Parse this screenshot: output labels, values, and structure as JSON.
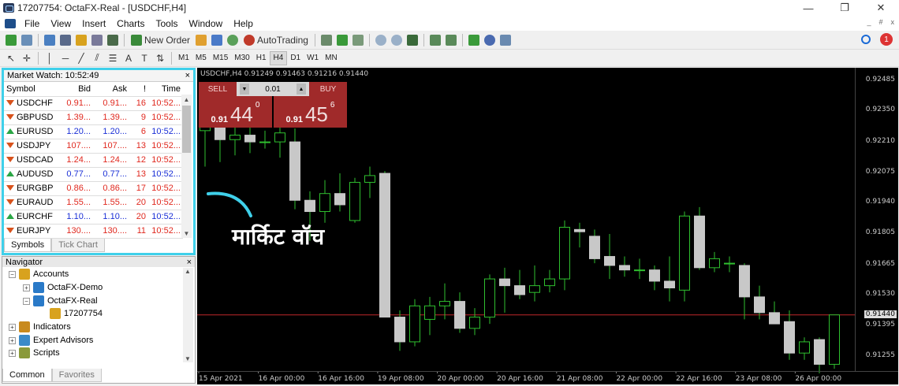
{
  "window": {
    "title": "17207754: OctaFX-Real - [USDCHF,H4]",
    "minimize": "—",
    "maximize": "❐",
    "close": "✕"
  },
  "menu": {
    "items": [
      "File",
      "View",
      "Insert",
      "Charts",
      "Tools",
      "Window",
      "Help"
    ],
    "mdi_controls": [
      "_",
      "#",
      "x"
    ]
  },
  "toolbar": {
    "new_order": "New Order",
    "autotrading": "AutoTrading",
    "timeframes": [
      "M1",
      "M5",
      "M15",
      "M30",
      "H1",
      "H4",
      "D1",
      "W1",
      "MN"
    ],
    "active_timeframe": "H4",
    "notification_count": "1",
    "drawing": {
      "text_tool": "A",
      "text_label_tool": "T"
    }
  },
  "market_watch": {
    "title": "Market Watch: 10:52:49",
    "close": "×",
    "columns": [
      "Symbol",
      "Bid",
      "Ask",
      "!",
      "Time"
    ],
    "rows": [
      {
        "symbol": "USDCHF",
        "dir": "down",
        "bid": "0.91...",
        "ask": "0.91...",
        "spread": "16",
        "time": "10:52...",
        "color": "red"
      },
      {
        "symbol": "GBPUSD",
        "dir": "down",
        "bid": "1.39...",
        "ask": "1.39...",
        "spread": "9",
        "time": "10:52...",
        "color": "red"
      },
      {
        "symbol": "EURUSD",
        "dir": "up",
        "bid": "1.20...",
        "ask": "1.20...",
        "spread": "6",
        "time": "10:52...",
        "color": "blue"
      },
      {
        "symbol": "USDJPY",
        "dir": "down",
        "bid": "107....",
        "ask": "107....",
        "spread": "13",
        "time": "10:52...",
        "color": "red"
      },
      {
        "symbol": "USDCAD",
        "dir": "down",
        "bid": "1.24...",
        "ask": "1.24...",
        "spread": "12",
        "time": "10:52...",
        "color": "red"
      },
      {
        "symbol": "AUDUSD",
        "dir": "up",
        "bid": "0.77...",
        "ask": "0.77...",
        "spread": "13",
        "time": "10:52...",
        "color": "blue"
      },
      {
        "symbol": "EURGBP",
        "dir": "down",
        "bid": "0.86...",
        "ask": "0.86...",
        "spread": "17",
        "time": "10:52...",
        "color": "red"
      },
      {
        "symbol": "EURAUD",
        "dir": "down",
        "bid": "1.55...",
        "ask": "1.55...",
        "spread": "20",
        "time": "10:52...",
        "color": "red"
      },
      {
        "symbol": "EURCHF",
        "dir": "up",
        "bid": "1.10...",
        "ask": "1.10...",
        "spread": "20",
        "time": "10:52...",
        "color": "blue"
      },
      {
        "symbol": "EURJPY",
        "dir": "down",
        "bid": "130....",
        "ask": "130....",
        "spread": "11",
        "time": "10:52...",
        "color": "red"
      }
    ],
    "tabs": [
      "Symbols",
      "Tick Chart"
    ],
    "active_tab": "Symbols"
  },
  "navigator": {
    "title": "Navigator",
    "close": "×",
    "items": {
      "accounts": "Accounts",
      "demo": "OctaFX-Demo",
      "real": "OctaFX-Real",
      "account_number": "17207754",
      "indicators": "Indicators",
      "experts": "Expert Advisors",
      "scripts": "Scripts"
    },
    "tabs": [
      "Common",
      "Favorites"
    ],
    "active_tab": "Common"
  },
  "one_click": {
    "sell": "SELL",
    "buy": "BUY",
    "lot": "0.01",
    "sell_prefix": "0.91",
    "sell_big": "44",
    "sell_sup": "0",
    "buy_prefix": "0.91",
    "buy_big": "45",
    "buy_sup": "6"
  },
  "chart": {
    "info": "USDCHF,H4  0.91249 0.91463 0.91216 0.91440",
    "current_price": "0.91440",
    "price_line_color": "#c0282a"
  },
  "annotation": {
    "text": "मार्किट वॉच",
    "color": "#3fd0ea"
  },
  "chart_data": {
    "type": "candlestick",
    "symbol": "USDCHF",
    "timeframe": "H4",
    "y_ticks": [
      "0.92485",
      "0.92350",
      "0.92210",
      "0.92075",
      "0.91940",
      "0.91805",
      "0.91665",
      "0.91530",
      "0.91395",
      "0.91255"
    ],
    "ylim": [
      0.9119,
      0.9254
    ],
    "x_ticks": [
      "15 Apr 2021",
      "16 Apr 00:00",
      "16 Apr 16:00",
      "19 Apr 08:00",
      "20 Apr 00:00",
      "20 Apr 16:00",
      "21 Apr 08:00",
      "22 Apr 00:00",
      "22 Apr 16:00",
      "23 Apr 08:00",
      "26 Apr 00:00"
    ],
    "candles": [
      {
        "o": 0.9226,
        "h": 0.9235,
        "l": 0.921,
        "c": 0.9228
      },
      {
        "o": 0.9228,
        "h": 0.9238,
        "l": 0.9212,
        "c": 0.9222
      },
      {
        "o": 0.9222,
        "h": 0.923,
        "l": 0.9215,
        "c": 0.9224
      },
      {
        "o": 0.9224,
        "h": 0.923,
        "l": 0.9216,
        "c": 0.9221
      },
      {
        "o": 0.9221,
        "h": 0.9226,
        "l": 0.9218,
        "c": 0.9221
      },
      {
        "o": 0.9221,
        "h": 0.9231,
        "l": 0.9214,
        "c": 0.9225
      },
      {
        "o": 0.9221,
        "h": 0.9227,
        "l": 0.9191,
        "c": 0.9195
      },
      {
        "o": 0.9195,
        "h": 0.9199,
        "l": 0.9177,
        "c": 0.919
      },
      {
        "o": 0.919,
        "h": 0.9204,
        "l": 0.9185,
        "c": 0.9198
      },
      {
        "o": 0.9198,
        "h": 0.9207,
        "l": 0.919,
        "c": 0.9193
      },
      {
        "o": 0.9186,
        "h": 0.9205,
        "l": 0.9185,
        "c": 0.9203
      },
      {
        "o": 0.9203,
        "h": 0.921,
        "l": 0.9196,
        "c": 0.9206
      },
      {
        "o": 0.9207,
        "h": 0.9208,
        "l": 0.9143,
        "c": 0.9143
      },
      {
        "o": 0.9143,
        "h": 0.9146,
        "l": 0.9128,
        "c": 0.9132
      },
      {
        "o": 0.9132,
        "h": 0.9151,
        "l": 0.913,
        "c": 0.9148
      },
      {
        "o": 0.9142,
        "h": 0.9152,
        "l": 0.9135,
        "c": 0.9148
      },
      {
        "o": 0.9148,
        "h": 0.9158,
        "l": 0.9142,
        "c": 0.915
      },
      {
        "o": 0.915,
        "h": 0.9154,
        "l": 0.9136,
        "c": 0.9138
      },
      {
        "o": 0.9138,
        "h": 0.9147,
        "l": 0.9135,
        "c": 0.9143
      },
      {
        "o": 0.9143,
        "h": 0.9162,
        "l": 0.914,
        "c": 0.916
      },
      {
        "o": 0.916,
        "h": 0.9165,
        "l": 0.9145,
        "c": 0.9157
      },
      {
        "o": 0.9157,
        "h": 0.9164,
        "l": 0.9151,
        "c": 0.9153
      },
      {
        "o": 0.9154,
        "h": 0.9166,
        "l": 0.915,
        "c": 0.9157
      },
      {
        "o": 0.9157,
        "h": 0.9164,
        "l": 0.9154,
        "c": 0.916
      },
      {
        "o": 0.916,
        "h": 0.9186,
        "l": 0.9155,
        "c": 0.9183
      },
      {
        "o": 0.9182,
        "h": 0.9185,
        "l": 0.9174,
        "c": 0.9181
      },
      {
        "o": 0.9179,
        "h": 0.9182,
        "l": 0.9167,
        "c": 0.9169
      },
      {
        "o": 0.917,
        "h": 0.918,
        "l": 0.916,
        "c": 0.9166
      },
      {
        "o": 0.9166,
        "h": 0.917,
        "l": 0.9161,
        "c": 0.9164
      },
      {
        "o": 0.9164,
        "h": 0.9169,
        "l": 0.916,
        "c": 0.9164
      },
      {
        "o": 0.9164,
        "h": 0.9166,
        "l": 0.9155,
        "c": 0.9159
      },
      {
        "o": 0.9159,
        "h": 0.917,
        "l": 0.915,
        "c": 0.9156
      },
      {
        "o": 0.9155,
        "h": 0.919,
        "l": 0.915,
        "c": 0.9188
      },
      {
        "o": 0.9188,
        "h": 0.9192,
        "l": 0.9164,
        "c": 0.9165
      },
      {
        "o": 0.9165,
        "h": 0.9172,
        "l": 0.9163,
        "c": 0.9169
      },
      {
        "o": 0.9167,
        "h": 0.917,
        "l": 0.9163,
        "c": 0.9167
      },
      {
        "o": 0.9166,
        "h": 0.9167,
        "l": 0.9142,
        "c": 0.9152
      },
      {
        "o": 0.9152,
        "h": 0.9157,
        "l": 0.9142,
        "c": 0.9145
      },
      {
        "o": 0.9145,
        "h": 0.915,
        "l": 0.914,
        "c": 0.914
      },
      {
        "o": 0.9141,
        "h": 0.9146,
        "l": 0.9124,
        "c": 0.9127
      },
      {
        "o": 0.9127,
        "h": 0.9134,
        "l": 0.9124,
        "c": 0.9132
      },
      {
        "o": 0.9133,
        "h": 0.9134,
        "l": 0.9118,
        "c": 0.9122
      },
      {
        "o": 0.9122,
        "h": 0.9144,
        "l": 0.912,
        "c": 0.9144
      }
    ]
  }
}
